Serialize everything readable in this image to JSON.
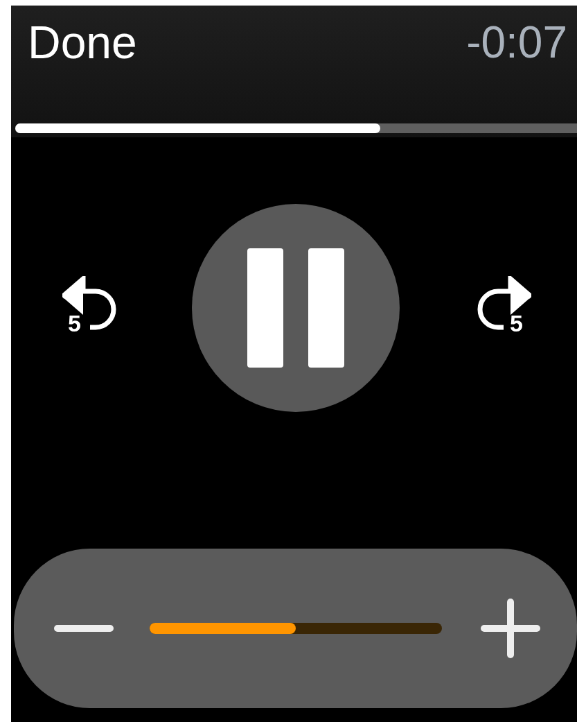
{
  "header": {
    "done": "Done",
    "remaining": "-0:07"
  },
  "progress": {
    "level": 0.65
  },
  "controls": {
    "skip_back": "5",
    "playing": true,
    "skip_forward": "5"
  },
  "volume": {
    "level": 0.5
  }
}
